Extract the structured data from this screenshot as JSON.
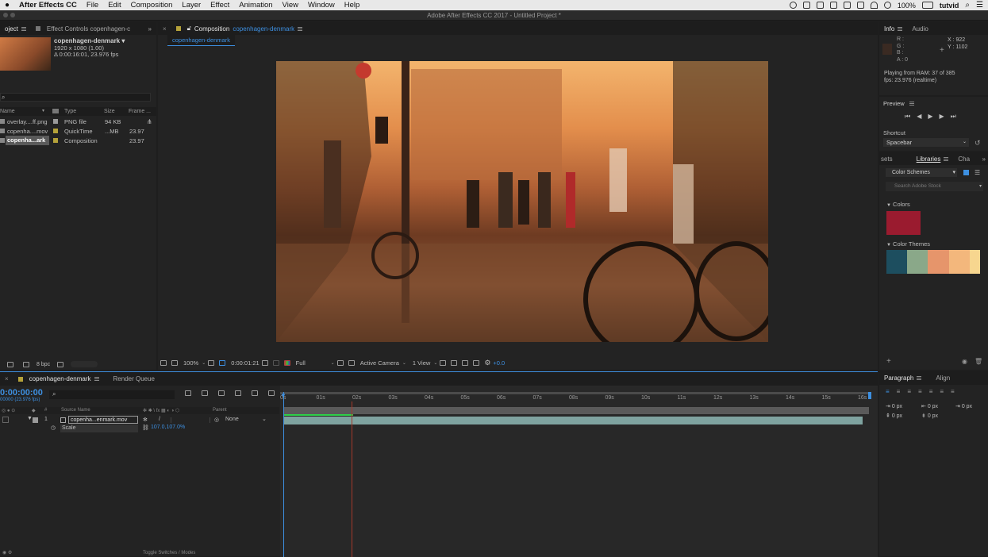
{
  "menubar": {
    "apple": "",
    "app_name": "After Effects CC",
    "items": [
      "File",
      "Edit",
      "Composition",
      "Layer",
      "Effect",
      "Animation",
      "View",
      "Window",
      "Help"
    ],
    "battery": "100%",
    "user": "tutvid"
  },
  "window_title": "Adobe After Effects CC 2017 - Untitled Project *",
  "project_panel": {
    "tab_project": "oject",
    "tab_effect_controls": "Effect Controls copenhagen-c",
    "item_name": "copenhagen-denmark ▾",
    "item_res": "1920 x 1080 (1.00)",
    "item_duration": "Δ 0:00:16:01, 23.976 fps",
    "columns": {
      "name": "Name",
      "type": "Type",
      "size": "Size",
      "frame": "Frame ..."
    },
    "items": [
      {
        "name": "overlay....ff.png",
        "type": "PNG file",
        "size": "94 KB",
        "frame": ""
      },
      {
        "name": "copenha....mov",
        "type": "QuickTime",
        "size": "...MB",
        "frame": "23.97"
      },
      {
        "name": "copenha...ark",
        "type": "Composition",
        "size": "",
        "frame": "23.97"
      }
    ],
    "bpc": "8 bpc"
  },
  "comp_panel": {
    "tab_prefix": "Composition",
    "tab_name": "copenhagen-denmark",
    "breadcrumb": "copenhagen-denmark",
    "zoom": "100%",
    "timecode": "0:00:01:21",
    "resolution": "Full",
    "camera": "Active Camera",
    "view": "1 View",
    "exposure": "+0.0"
  },
  "info_panel": {
    "tab_info": "Info",
    "tab_audio": "Audio",
    "r": "R :",
    "g": "G :",
    "b": "B :",
    "a": "A : 0",
    "x": "X : 922",
    "y": "Y : 1102",
    "status1": "Playing from RAM: 37 of 385",
    "status2": "fps: 23.976 (realtime)"
  },
  "preview_panel": {
    "title": "Preview",
    "shortcut_label": "Shortcut",
    "shortcut_value": "Spacebar"
  },
  "libraries_panel": {
    "tab_sets": "sets",
    "tab_libraries": "Libraries",
    "tab_cha": "Cha",
    "library_select": "Color Schemes",
    "search_placeholder": "Search Adobe Stock",
    "colors_label": "Colors",
    "themes_label": "Color Themes",
    "color_swatch": "#9a1b2f",
    "theme_colors": [
      "#1d4e5f",
      "#8aa889",
      "#e6956b",
      "#f3b77c",
      "#f7d68f"
    ]
  },
  "timeline_panel": {
    "tab_comp": "copenhagen-denmark",
    "tab_render": "Render Queue",
    "timecode": "0:00:00:00",
    "timecode_sub": "00000 (23.976 fps)",
    "col_source": "Source Name",
    "col_parent": "Parent",
    "layer_num": "1",
    "layer_name": "copenha...enmark.mov",
    "parent_value": "None",
    "prop_name": "Scale",
    "prop_value": "107.0,107.0%",
    "ruler": [
      "0s",
      "01s",
      "02s",
      "03s",
      "04s",
      "05s",
      "06s",
      "07s",
      "08s",
      "09s",
      "10s",
      "11s",
      "12s",
      "13s",
      "14s",
      "15s",
      "16s"
    ],
    "footer": "Toggle Switches / Modes"
  },
  "paragraph_panel": {
    "tab_paragraph": "Paragraph",
    "tab_align": "Align",
    "f1": "0 px",
    "f2": "0 px",
    "f3": "0 px",
    "f4": "0 px",
    "f5": "0 px"
  }
}
